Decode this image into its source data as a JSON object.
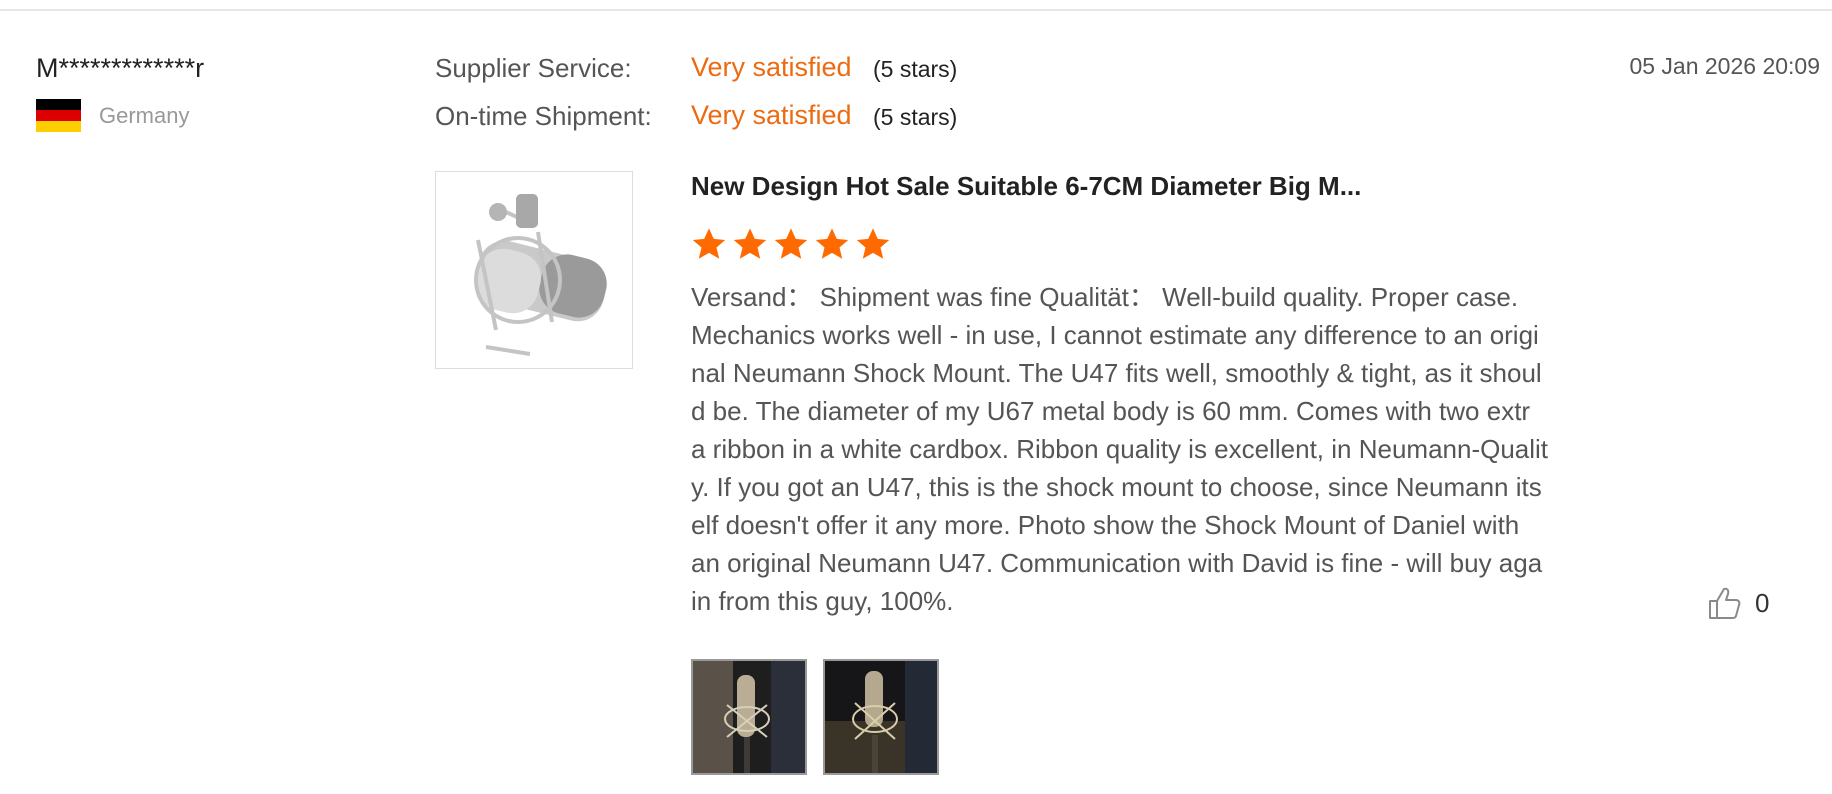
{
  "reviewer": {
    "name": "M*************r",
    "country": "Germany",
    "flag_colors": [
      "#000000",
      "#dd0000",
      "#ffce00"
    ]
  },
  "ratings": [
    {
      "label": "Supplier Service:",
      "value": "Very satisfied",
      "stars_text": "(5 stars)"
    },
    {
      "label": "On-time Shipment:",
      "value": "Very satisfied",
      "stars_text": "(5 stars)"
    }
  ],
  "date": "05 Jan 2026 20:09",
  "product": {
    "title": "New Design Hot Sale Suitable 6-7CM Diameter Big M...",
    "thumbnail_icon": "microphone-shock-mount-image",
    "star_rating": 5,
    "star_color": "#ff6a00"
  },
  "review_text": "Versand：  Shipment was fine Qualität：  Well-build quality. Proper case.\nMechanics works well - in use, I cannot estimate any difference to an origi\nnal Neumann Shock Mount. The U47 fits well, smoothly & tight, as it shoul\nd be. The diameter of my U67 metal body is 60 mm. Comes with two extr\na ribbon in a white cardbox. Ribbon quality is excellent, in Neumann-Qualit\ny. If you got an U47, this is the shock mount to choose, since Neumann its\nelf doesn't offer it any more. Photo show the Shock Mount of Daniel with\nan original Neumann U47. Communication with David is fine - will buy aga\nin from this guy, 100%.",
  "like": {
    "icon": "thumbs-up-icon",
    "count": "0"
  },
  "photos": [
    {
      "icon": "review-photo-icon"
    },
    {
      "icon": "review-photo-icon"
    }
  ],
  "accent_color": "#ee6a10"
}
